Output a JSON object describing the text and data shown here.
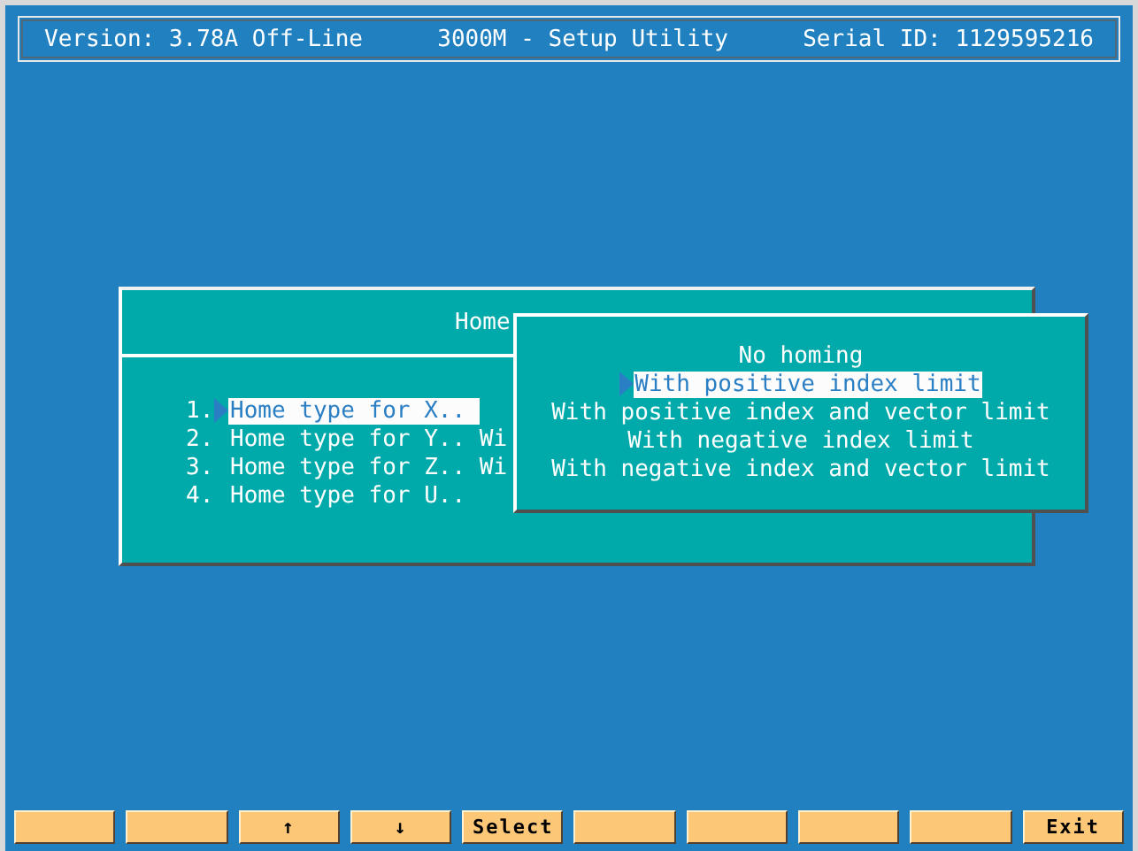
{
  "header": {
    "version": "Version: 3.78A Off-Line",
    "title": "3000M - Setup Utility",
    "serial": "Serial ID: 1129595216"
  },
  "dialog": {
    "title": "Home",
    "items": [
      {
        "number": "1.",
        "label": "Home type for X..",
        "selected": true
      },
      {
        "number": "2.",
        "label": "Home type for Y.. Wi",
        "selected": false
      },
      {
        "number": "3.",
        "label": "Home type for Z.. Wi",
        "selected": false
      },
      {
        "number": "4.",
        "label": "Home type for U..",
        "selected": false
      }
    ]
  },
  "popup": {
    "options": [
      {
        "label": "No homing",
        "selected": false
      },
      {
        "label": "With positive index limit",
        "selected": true
      },
      {
        "label": "With positive index and vector limit",
        "selected": false
      },
      {
        "label": "With negative index limit",
        "selected": false
      },
      {
        "label": "With negative index and vector limit",
        "selected": false
      }
    ]
  },
  "function_keys": [
    {
      "kind": "blank"
    },
    {
      "kind": "blank"
    },
    {
      "kind": "labeled",
      "label": "↑"
    },
    {
      "kind": "labeled",
      "label": "↓"
    },
    {
      "kind": "labeled",
      "label": "Select"
    },
    {
      "kind": "blank"
    },
    {
      "kind": "blank"
    },
    {
      "kind": "blank"
    },
    {
      "kind": "blank"
    },
    {
      "kind": "labeled",
      "label": "Exit"
    }
  ]
}
